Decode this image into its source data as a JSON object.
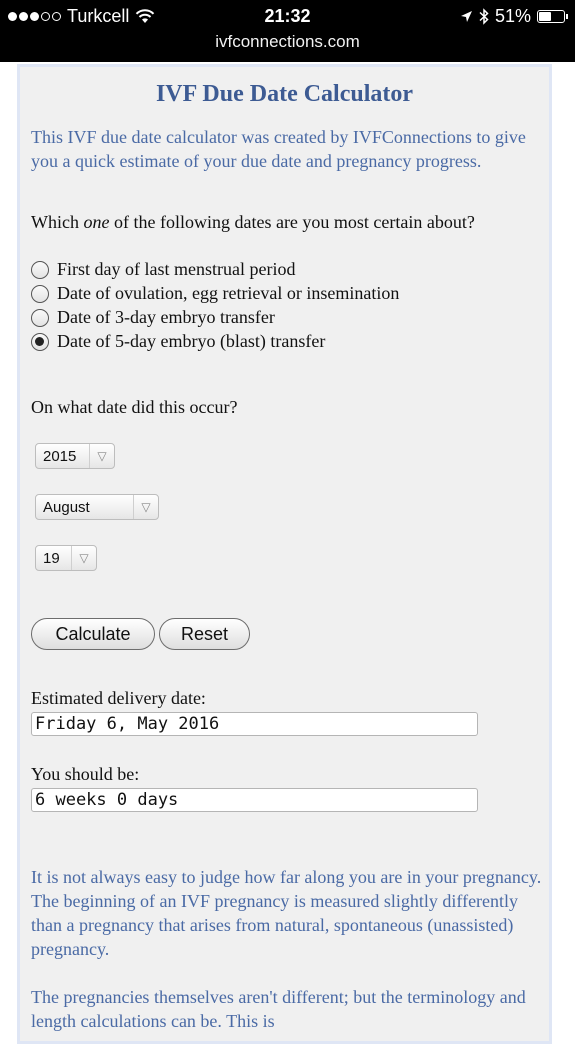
{
  "status_bar": {
    "carrier": "Turkcell",
    "time": "21:32",
    "battery": "51%",
    "battery_level": 0.51,
    "url": "ivfconnections.com",
    "icons": [
      "signal-dots-icon",
      "wifi-icon",
      "location-arrow-icon",
      "bluetooth-icon",
      "battery-icon"
    ]
  },
  "page": {
    "title": "IVF Due Date Calculator",
    "intro": "This IVF due date calculator was created by IVFConnections to give you a quick estimate of your due date and pregnancy progress.",
    "question_before": "Which ",
    "question_emphasis": "one",
    "question_after": " of the following dates are you most certain about?",
    "options": [
      {
        "label": "First day of last menstrual period",
        "checked": false
      },
      {
        "label": "Date of ovulation, egg retrieval or insemination",
        "checked": false
      },
      {
        "label": "Date of 3-day embryo transfer",
        "checked": false
      },
      {
        "label": "Date of 5-day embryo (blast) transfer",
        "checked": true
      }
    ],
    "date_question": "On what date did this occur?",
    "year_select": "2015",
    "month_select": "August",
    "day_select": "19",
    "calculate_label": "Calculate",
    "reset_label": "Reset",
    "delivery_label": "Estimated delivery date:",
    "delivery_value": "Friday 6, May 2016",
    "progress_label": "You should be:",
    "progress_value": "6 weeks 0 days",
    "paragraph1": "It is not always easy to judge how far along you are in your pregnancy. The beginning of an IVF pregnancy is measured slightly differently than a pregnancy that arises from natural, spontaneous (unassisted) pregnancy.",
    "paragraph2": "The pregnancies themselves aren't different; but the terminology and length calculations can be. This is"
  },
  "colors": {
    "title": "#3d5b93",
    "intro_text": "#4a6aa5",
    "panel_bg": "#f0f0f0",
    "panel_border": "#dfe6f5"
  }
}
